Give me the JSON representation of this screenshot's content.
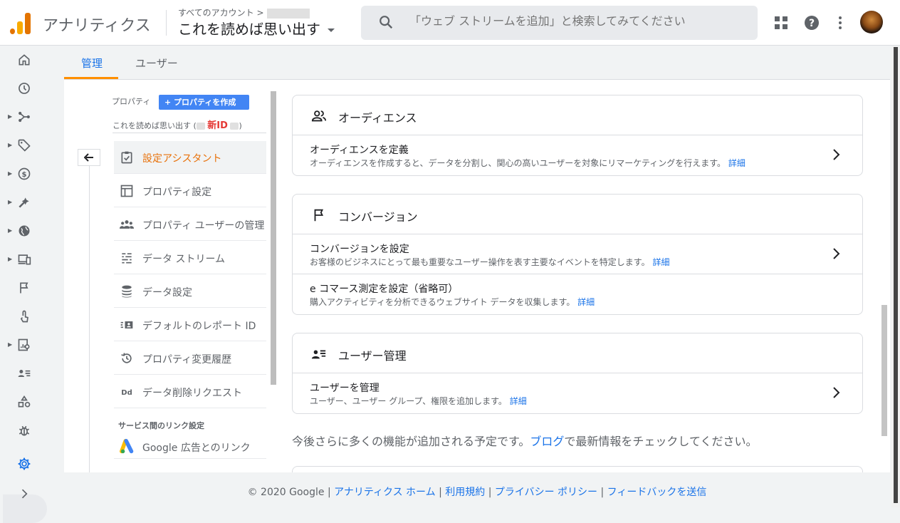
{
  "header": {
    "brand": "アナリティクス",
    "breadcrumb": "すべてのアカウント >",
    "property_title": "これを読めば思い出す",
    "search_placeholder": "「ウェブ ストリームを追加」と検索してみてください"
  },
  "tabs": [
    {
      "label": "管理",
      "active": true
    },
    {
      "label": "ユーザー",
      "active": false
    }
  ],
  "property_panel": {
    "label": "プロパティ",
    "create_button": "+ プロパティを作成",
    "name": "これを読めば思い出す (",
    "name_close": ")",
    "new_id_badge": "新ID",
    "menu": [
      {
        "label": "設定アシスタント",
        "icon": "checklist-icon",
        "selected": true
      },
      {
        "label": "プロパティ設定",
        "icon": "layout-icon"
      },
      {
        "label": "プロパティ ユーザーの管理",
        "icon": "people-icon"
      },
      {
        "label": "データ ストリーム",
        "icon": "stream-icon"
      },
      {
        "label": "データ設定",
        "icon": "database-icon"
      },
      {
        "label": "デフォルトのレポート ID",
        "icon": "id-card-icon"
      },
      {
        "label": "プロパティ変更履歴",
        "icon": "history-icon"
      },
      {
        "label": "データ削除リクエスト",
        "icon": "dd-icon"
      }
    ],
    "section_label": "サービス間のリンク設定",
    "ads_link": "Google 広告とのリンク"
  },
  "cards": [
    {
      "title": "オーディエンス",
      "icon": "audience-icon",
      "rows": [
        {
          "title": "オーディエンスを定義",
          "desc": "オーディエンスを作成すると、データを分割し、関心の高いユーザーを対象にリマーケティングを行えます。",
          "link": "詳細",
          "chevron": true
        }
      ]
    },
    {
      "title": "コンバージョン",
      "icon": "flag-icon",
      "rows": [
        {
          "title": "コンバージョンを設定",
          "desc": "お客様のビジネスにとって最も重要なユーザー操作を表す主要なイベントを特定します。",
          "link": "詳細",
          "chevron": true
        },
        {
          "title": "e コマース測定を設定（省略可）",
          "desc": "購入アクティビティを分析できるウェブサイト データを収集します。",
          "link": "詳細",
          "chevron": false
        }
      ]
    },
    {
      "title": "ユーザー管理",
      "icon": "user-list-icon",
      "rows": [
        {
          "title": "ユーザーを管理",
          "desc": "ユーザー、ユーザー グループ、権限を追加します。",
          "link": "詳細",
          "chevron": true
        }
      ]
    }
  ],
  "footnote": {
    "before": "今後さらに多くの機能が追加される予定です。",
    "link": "ブログ",
    "after": "で最新情報をチェックしてください。"
  },
  "footer": {
    "copyright": "© 2020 Google",
    "links": [
      "アナリティクス ホーム",
      "利用規約",
      "プライバシー ポリシー",
      "フィードバックを送信"
    ]
  },
  "colors": {
    "accent": "#1a73e8",
    "active_tab_underline": "#ff8f00",
    "selected_menu": "#e8710a",
    "new_id": "#e53935"
  }
}
